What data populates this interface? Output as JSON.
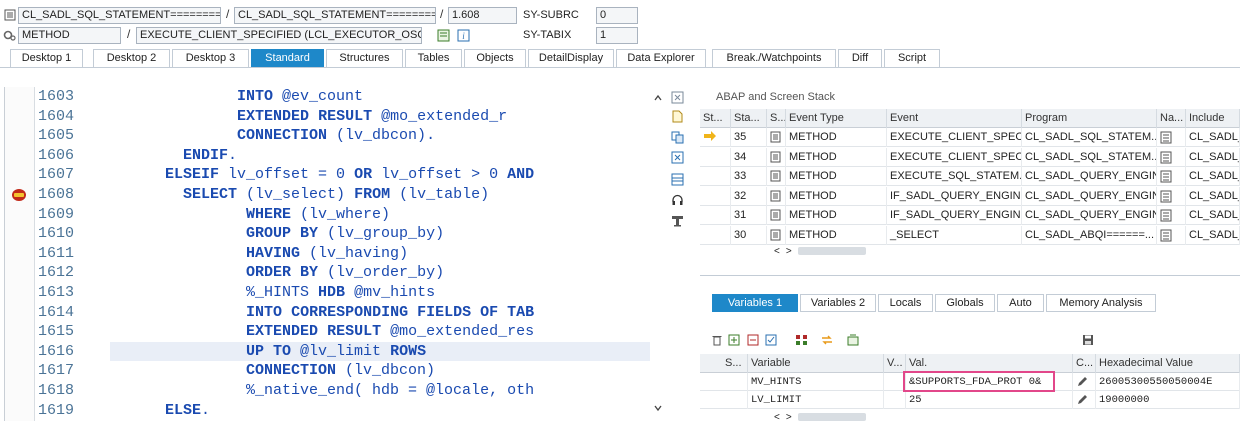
{
  "header": {
    "row1": {
      "field1": "CL_SADL_SQL_STATEMENT========",
      "field2": "CL_SADL_SQL_STATEMENT========",
      "field3": "1.608",
      "label": "SY-SUBRC",
      "value": "0"
    },
    "row2": {
      "field1": "METHOD",
      "field2": "EXECUTE_CLIENT_SPECIFIED (LCL_EXECUTOR_OSQL)",
      "label": "SY-TABIX",
      "value": "1"
    },
    "separators": [
      "/",
      "/",
      "/",
      "/"
    ]
  },
  "tabs": [
    {
      "label": "Desktop 1"
    },
    {
      "label": "Desktop 2"
    },
    {
      "label": "Desktop 3"
    },
    {
      "label": "Standard",
      "active": true
    },
    {
      "label": "Structures"
    },
    {
      "label": "Tables"
    },
    {
      "label": "Objects"
    },
    {
      "label": "DetailDisplay"
    },
    {
      "label": "Data Explorer"
    },
    {
      "label": "Break./Watchpoints"
    },
    {
      "label": "Diff"
    },
    {
      "label": "Script"
    }
  ],
  "editor": {
    "lines": [
      {
        "num": "1603",
        "code": "                INTO @ev_count"
      },
      {
        "num": "1604",
        "code": "                EXTENDED RESULT @mo_extended_r"
      },
      {
        "num": "1605",
        "code": "                CONNECTION (lv_dbcon)."
      },
      {
        "num": "1606",
        "code": "          ENDIF."
      },
      {
        "num": "1607",
        "code": "        ELSEIF lv_offset = 0 OR lv_offset > 0 AND"
      },
      {
        "num": "1608",
        "code": "          SELECT (lv_select) FROM (lv_table)",
        "breakpoint": true
      },
      {
        "num": "1609",
        "code": "                 WHERE (lv_where)"
      },
      {
        "num": "1610",
        "code": "                 GROUP BY (lv_group_by)"
      },
      {
        "num": "1611",
        "code": "                 HAVING (lv_having)"
      },
      {
        "num": "1612",
        "code": "                 ORDER BY (lv_order_by)"
      },
      {
        "num": "1613",
        "code": "                 %_HINTS HDB @mv_hints"
      },
      {
        "num": "1614",
        "code": "                 INTO CORRESPONDING FIELDS OF TAB"
      },
      {
        "num": "1615",
        "code": "                 EXTENDED RESULT @mo_extended_res"
      },
      {
        "num": "1616",
        "code": "                 UP TO @lv_limit ROWS",
        "highlight": true
      },
      {
        "num": "1617",
        "code": "                 CONNECTION (lv_dbcon)"
      },
      {
        "num": "1618",
        "code": "                 %_native_end( hdb = @locale, oth"
      },
      {
        "num": "1619",
        "code": "        ELSE."
      }
    ]
  },
  "stack": {
    "title": "ABAP and Screen Stack",
    "columns": [
      "St...",
      "Sta...",
      "S...",
      "Event Type",
      "Event",
      "Program",
      "Na...",
      "Include"
    ],
    "rows": [
      {
        "level": "35",
        "type": "METHOD",
        "event": "EXECUTE_CLIENT_SPECI...",
        "program": "CL_SADL_SQL_STATEM...",
        "include": "CL_SADL_",
        "current": true
      },
      {
        "level": "34",
        "type": "METHOD",
        "event": "EXECUTE_CLIENT_SPECI...",
        "program": "CL_SADL_SQL_STATEM...",
        "include": "CL_SADL_"
      },
      {
        "level": "33",
        "type": "METHOD",
        "event": "EXECUTE_SQL_STATEM...",
        "program": "CL_SADL_QUERY_ENGIN...",
        "include": "CL_SADL_"
      },
      {
        "level": "32",
        "type": "METHOD",
        "event": "IF_SADL_QUERY_ENGIN...",
        "program": "CL_SADL_QUERY_ENGIN...",
        "include": "CL_SADL_"
      },
      {
        "level": "31",
        "type": "METHOD",
        "event": "IF_SADL_QUERY_ENGIN...",
        "program": "CL_SADL_QUERY_ENGIN...",
        "include": "CL_SADL_"
      },
      {
        "level": "30",
        "type": "METHOD",
        "event": "_SELECT",
        "program": "CL_SADL_ABQI======...",
        "include": "CL_SADL_"
      }
    ]
  },
  "variables": {
    "tabs": [
      {
        "label": "Variables 1",
        "active": true
      },
      {
        "label": "Variables 2"
      },
      {
        "label": "Locals"
      },
      {
        "label": "Globals"
      },
      {
        "label": "Auto"
      },
      {
        "label": "Memory Analysis"
      }
    ],
    "columns": [
      "S...",
      "Variable",
      "V...",
      "Val.",
      "C...",
      "Hexadecimal Value"
    ],
    "rows": [
      {
        "name": "MV_HINTS",
        "value": "&SUPPORTS_FDA_PROT 0&",
        "hex": "26005300550050004E"
      },
      {
        "name": "LV_LIMIT",
        "value": "25",
        "hex": "19000000"
      }
    ]
  },
  "colors": {
    "accent": "#1e88c9",
    "keyword": "#1a4ab0",
    "line_number": "#4a7396",
    "highlight_box": "#e2478a"
  },
  "icons": [
    "list-icon",
    "method-icon",
    "info-icon",
    "check-icon",
    "breakpoint-icon",
    "arrow-right-icon",
    "document-icon",
    "trash-icon",
    "save-icon",
    "edit-icon"
  ]
}
